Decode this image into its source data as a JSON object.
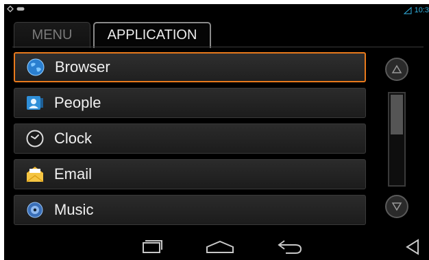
{
  "status": {
    "time": "10:3"
  },
  "tabs": [
    {
      "label": "MENU",
      "active": false
    },
    {
      "label": "APPLICATION",
      "active": true
    }
  ],
  "apps": [
    {
      "label": "Browser",
      "icon": "globe-icon",
      "focused": true
    },
    {
      "label": "People",
      "icon": "contact-card-icon",
      "focused": false
    },
    {
      "label": "Clock",
      "icon": "clock-icon",
      "focused": false
    },
    {
      "label": "Email",
      "icon": "envelope-icon",
      "focused": false
    },
    {
      "label": "Music",
      "icon": "music-disc-icon",
      "focused": false
    }
  ],
  "scroll": {
    "position": 0
  },
  "colors": {
    "focus": "#e97a1c",
    "accent": "#33b5e5"
  }
}
